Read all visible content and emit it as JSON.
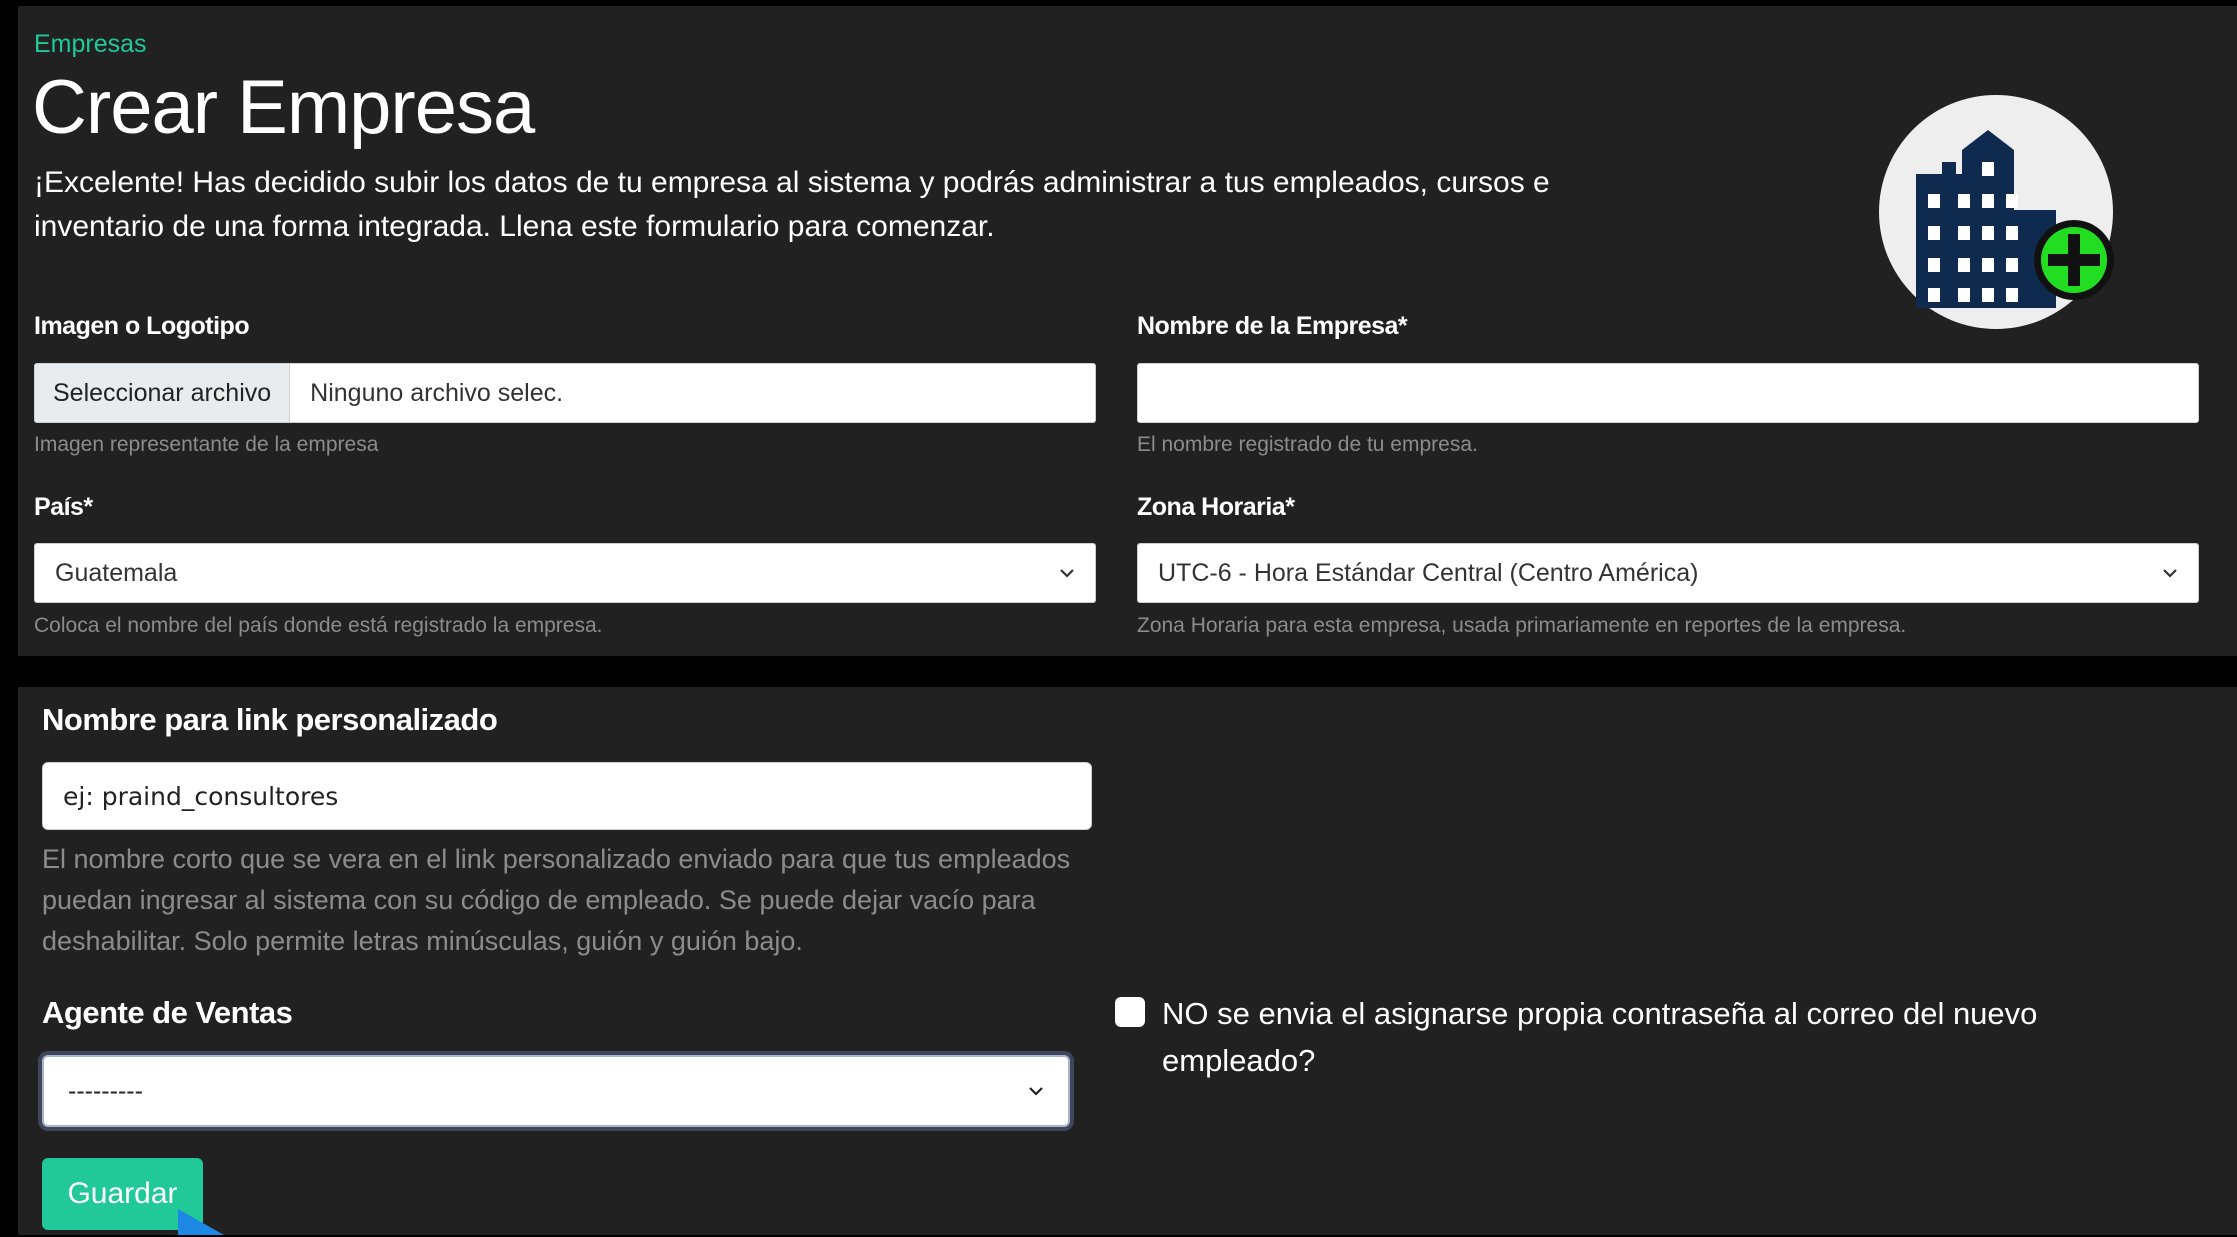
{
  "breadcrumb": "Empresas",
  "title": "Crear Empresa",
  "intro": "¡Excelente! Has decidido subir los datos de tu empresa al sistema y podrás administrar a tus empleados, cursos e inventario de una forma integrada. Llena este formulario para comenzar.",
  "hero_icon": "building-add-icon",
  "logo_field": {
    "label": "Imagen o Logotipo",
    "button": "Seleccionar archivo",
    "value": "Ninguno archivo selec.",
    "help": "Imagen representante de la empresa"
  },
  "company_name_field": {
    "label": "Nombre de la Empresa*",
    "value": "",
    "help": "El nombre registrado de tu empresa."
  },
  "country_field": {
    "label": "País*",
    "value": "Guatemala",
    "help": "Coloca el nombre del país donde está registrado la empresa."
  },
  "timezone_field": {
    "label": "Zona Horaria*",
    "value": "UTC-6 - Hora Estándar Central (Centro América)",
    "help": "Zona Horaria para esta empresa, usada primariamente en reportes de la empresa."
  },
  "custom_link_field": {
    "label": "Nombre para link personalizado",
    "placeholder": "ej: praind_consultores",
    "help": "El nombre corto que se vera en el link personalizado enviado para que tus empleados puedan ingresar al sistema con su código de empleado. Se puede dejar vacío para deshabilitar. Solo permite letras minúsculas, guión y guión bajo."
  },
  "sales_agent_field": {
    "label": "Agente de Ventas",
    "value": "---------"
  },
  "password_checkbox": {
    "label": "NO se envia el asignarse propia contraseña al correo del nuevo empleado?",
    "checked": false
  },
  "save_button": "Guardar",
  "colors": {
    "accent": "#20c997",
    "panel": "#212121",
    "icon_navy": "#0f2a4f",
    "icon_green": "#22dd22"
  }
}
